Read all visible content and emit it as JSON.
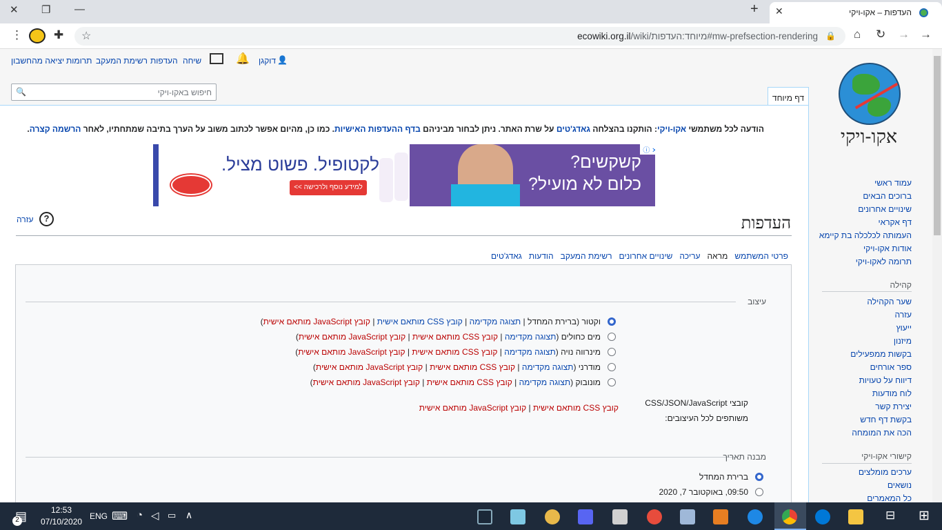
{
  "browser": {
    "tab_title": "העדפות – אקו-ויקי",
    "url_host": "ecowiki.org.il",
    "url_path": "/wiki/מיוחד:העדפות#mw-prefsection-rendering"
  },
  "personal": {
    "user": "דוקגן",
    "talk": "שיחה",
    "prefs": "העדפות",
    "watchlist": "רשימת המעקב",
    "contribs": "תרומות",
    "logout": "יציאה מהחשבון"
  },
  "search": {
    "placeholder": "חיפוש באקו-ויקי"
  },
  "special_tab": "דף מיוחד",
  "logo_text": "אקו-ויקי",
  "sitenotice": {
    "text1": "הודעה לכל משתמשי ",
    "link1": "אקו-ויקי",
    "text2": ": הותקנו בהצלחה ",
    "link2": "גאדג'טים",
    "text3": " על שרת האתר. ניתן לבחור מביניהם ",
    "link3": "בדף ההעדפות האישיות",
    "text4": ". כמו כן, מהיום אפשר לכתוב משוב על הערך בתיבה שמתחתיו, לאחר ",
    "link4": "הרשמה קצרה",
    "text5": "."
  },
  "ad": {
    "headline1": "קשקשים?",
    "headline2": "כלום לא מועיל?",
    "product": "לקטופיל. פשוט מציל.",
    "cta": "למידע נוסף ולרכישה >>"
  },
  "page": {
    "title": "העדפות",
    "help": "עזרה"
  },
  "tabs": [
    "פרטי המשתמש",
    "מראה",
    "עריכה",
    "שינויים אחרונים",
    "רשימת המעקב",
    "הודעות",
    "גאדג'טים"
  ],
  "nav": [
    "עמוד ראשי",
    "ברוכים הבאים",
    "שינויים אחרונים",
    "דף אקראי",
    "העמותה לכלכלה בת קיימא",
    "אודות אקו-ויקי",
    "תרומה לאקו-ויקי"
  ],
  "community_heading": "קהילה",
  "community": [
    "שער הקהילה",
    "עזרה",
    "ייעוץ",
    "מיזנון",
    "בקשות ממפעילים",
    "ספר אורחים",
    "דיווח על טעויות",
    "לוח מודעות",
    "יצירת קשר",
    "בקשת דף חדש",
    "הכה את המומחה"
  ],
  "links_heading": "קישורי אקו-ויקי",
  "links": [
    "ערכים מומלצים",
    "נושאים",
    "כל המאמרים"
  ],
  "skin_legend": "עיצוב",
  "skins": [
    {
      "name": "וקטור",
      "extra": " (ברירת המחדל",
      "checked": true
    },
    {
      "name": "מים כחולים",
      "extra": "",
      "checked": false
    },
    {
      "name": "מינרווה נויה",
      "extra": "",
      "checked": false
    },
    {
      "name": "מודרני",
      "extra": "",
      "checked": false
    },
    {
      "name": "מונובוק",
      "extra": "",
      "checked": false
    }
  ],
  "skin_links": {
    "preview": "תצוגה מקדימה",
    "css": "קובץ CSS מותאם אישית",
    "js": "קובץ JavaScript מותאם אישית"
  },
  "shared_label": "קובצי CSS/JSON/JavaScript משותפים לכל העיצובים:",
  "date_legend": "מבנה תאריך",
  "date_opts": [
    "ברירת המחדל",
    "09:50, באוקטובר 7, 2020"
  ],
  "taskbar": {
    "time": "12:53",
    "date": "07/10/2020",
    "lang": "ENG",
    "badge": "2"
  }
}
